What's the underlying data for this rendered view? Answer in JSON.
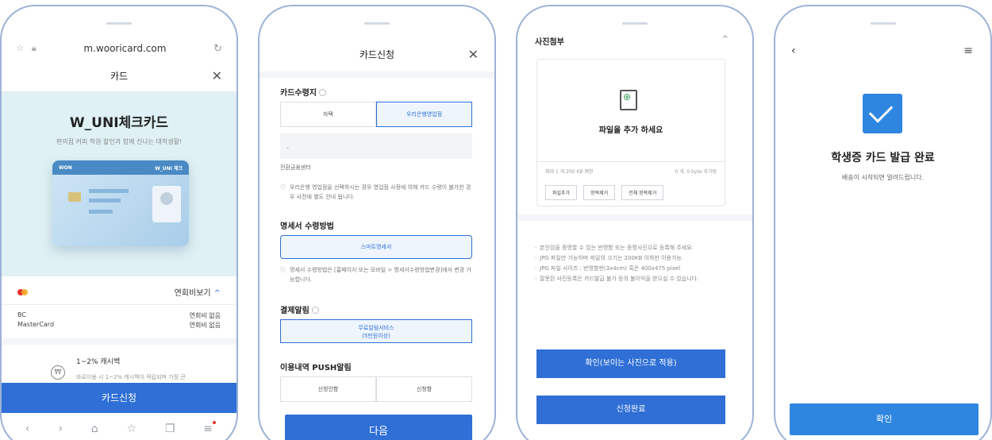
{
  "phone1": {
    "url": "m.wooricard.com",
    "page_title": "카드",
    "hero_title": "W_UNI체크카드",
    "hero_subtitle": "편의점 커피 학원 할인과 함께 신나는 대학생활!",
    "card_brand": "WON",
    "card_name": "W_UNI 체크",
    "fee_more_label": "연회비보기",
    "fee_rows": [
      {
        "brand": "BC",
        "fee": "연회비 없음"
      },
      {
        "brand": "MasterCard",
        "fee": "연회비 없음"
      }
    ],
    "benefit_title": "1~2% 캐시백",
    "benefit_desc": "바로이용 시 1~2% 캐시백이 적립되며 가장 큰",
    "apply_label": "카드신청"
  },
  "phone2": {
    "header_title": "카드신청",
    "section_receive": "카드수령지",
    "receive_options": [
      "자택",
      "우리은행영업점"
    ],
    "branch_value": "-",
    "center_label": "전환금융센터",
    "receive_note": "우리은행 영업점을 선택하시는 경우 영업점 사정에 의해 카드 수령이 불가한 경우 사전에 별도 안내 됩니다.",
    "section_statement": "명세서 수령방법",
    "statement_option": "스마트명세서",
    "statement_note": "명세서 수령방법은 [홈페이지 또는 모바일 > 명세서수령방법변경]에서 변경 가능합니다.",
    "section_alert": "결제알림",
    "alert_option_line1": "무료알림서비스",
    "alert_option_line2": "(5만원이상)",
    "section_push": "이용내역 PUSH알림",
    "push_options": [
      "신청안함",
      "신청함"
    ],
    "next_label": "다음"
  },
  "phone3": {
    "section_title": "사진첨부",
    "upload_title": "파일을 추가 하세요",
    "upload_limit": "최대 1 개 200 KB 제한",
    "upload_count": "0 개, 0 byte 추가됨",
    "upload_buttons": [
      "파일추가",
      "항목제거",
      "전체 항목제거"
    ],
    "bullets": [
      "본인임을 증명할 수 있는 반명함 또는 증명사진으로 등록해 주세요.",
      "JPG 파일만 가능하며 파일의 크기는 200KB 이하만 이용가능.",
      "JPG 파일 사이즈 : 반명함판(3x4cm) 혹은 400x475 pixel",
      "잘못된 사진등록은 카드발급 불가 등의 불이익을 받으실 수 있습니다."
    ],
    "confirm_label": "확인(보이는 사진으로 적용)",
    "complete_label": "신청완료"
  },
  "phone4": {
    "title": "학생증 카드 발급 완료",
    "subtitle": "배송이 시작되면 알려드립니다.",
    "ok_label": "확인"
  },
  "colors": {
    "accent": "#2f6fd6",
    "phone_frame": "#9db2d6",
    "hero_bg": "#dff1f4"
  }
}
